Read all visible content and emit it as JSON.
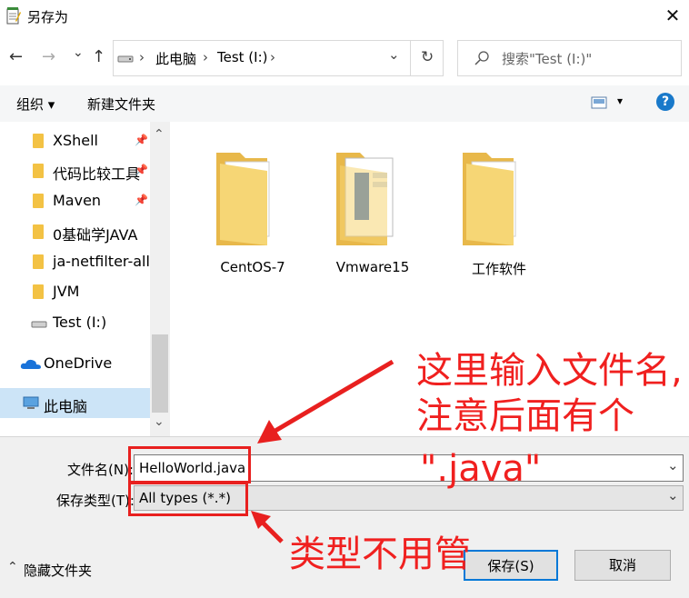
{
  "window": {
    "title": "另存为",
    "close_glyph": "✕"
  },
  "nav": {
    "back": "←",
    "forward": "→",
    "recent": "⌄",
    "up": "↑",
    "breadcrumb": [
      "此电脑",
      "Test (I:)"
    ],
    "sep": "›",
    "dropdown": "⌄",
    "refresh": "↻",
    "search_placeholder": "搜索\"Test (I:)\""
  },
  "toolbar": {
    "organize": "组织 ▾",
    "new_folder": "新建文件夹",
    "view_arrow": "▾",
    "help": "?"
  },
  "sidebar": {
    "items": [
      {
        "label": "XShell",
        "icon": "folder-icon",
        "pinned": true
      },
      {
        "label": "代码比较工具",
        "icon": "folder-icon",
        "pinned": true
      },
      {
        "label": "Maven",
        "icon": "folder-icon",
        "pinned": true
      },
      {
        "label": "0基础学JAVA",
        "icon": "folder-icon",
        "pinned": false
      },
      {
        "label": "ja-netfilter-all",
        "icon": "folder-icon",
        "pinned": false
      },
      {
        "label": "JVM",
        "icon": "folder-icon",
        "pinned": false
      },
      {
        "label": "Test (I:)",
        "icon": "drive-icon",
        "pinned": false
      },
      {
        "label": "OneDrive",
        "icon": "cloud-icon",
        "pinned": false
      },
      {
        "label": "此电脑",
        "icon": "computer-icon",
        "pinned": false
      }
    ],
    "pin_glyph": "📌",
    "scroll_up": "⌃",
    "scroll_down": "⌄"
  },
  "files": [
    {
      "name": "CentOS-7",
      "kind": "folder"
    },
    {
      "name": "Vmware15",
      "kind": "folder-with-docs"
    },
    {
      "name": "工作软件",
      "kind": "folder"
    }
  ],
  "form": {
    "filename_label": "文件名(N):",
    "filename_value": "HelloWorld.java",
    "filetype_label": "保存类型(T):",
    "filetype_value": "All types (*.*)",
    "dropdown": "⌄"
  },
  "footer": {
    "hide_folders": "隐藏文件夹",
    "hide_glyph": "⌃",
    "save": "保存(S)",
    "cancel": "取消"
  },
  "annotations": {
    "line1": "这里输入文件名,",
    "line2": "注意后面有个",
    "line3": "\".java\"",
    "type_note": "类型不用管",
    "color": "#f0201f"
  }
}
